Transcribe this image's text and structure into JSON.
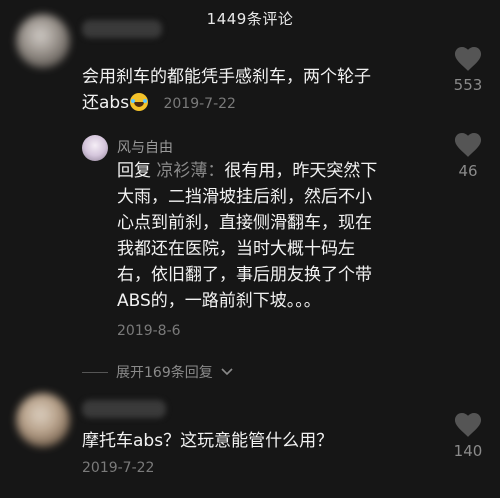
{
  "header": {
    "title": "1449条评论"
  },
  "comments": [
    {
      "text": "会用刹车的都能凭手感刹车，两个轮子还abs",
      "text_line1": "会用刹车的都能凭手感刹车，两个轮子",
      "text_line2": "还abs",
      "emoji": "laughing-tears-emoji",
      "date": "2019-7-22",
      "likes": "553"
    },
    {
      "text": "摩托车abs？这玩意能管什么用？",
      "date": "2019-7-22",
      "likes": "140"
    }
  ],
  "reply": {
    "author": "风与自由",
    "prefix": "回复",
    "mention": "凉衫薄：",
    "lines": [
      "很有用，昨天突然下",
      "大雨，二挡滑坡挂后刹，然后不小",
      "心点到前刹，直接侧滑翻车，现在",
      "我都还在医院，当时大概十码左",
      "右，依旧翻了，事后朋友换了个带",
      "ABS的，一路前刹下坡。。。"
    ],
    "date": "2019-8-6",
    "likes": "46"
  },
  "expand": {
    "label": "展开169条回复"
  },
  "colors": {
    "background": "#161616",
    "muted": "#8a8a8a",
    "text": "#f2f2f2"
  }
}
